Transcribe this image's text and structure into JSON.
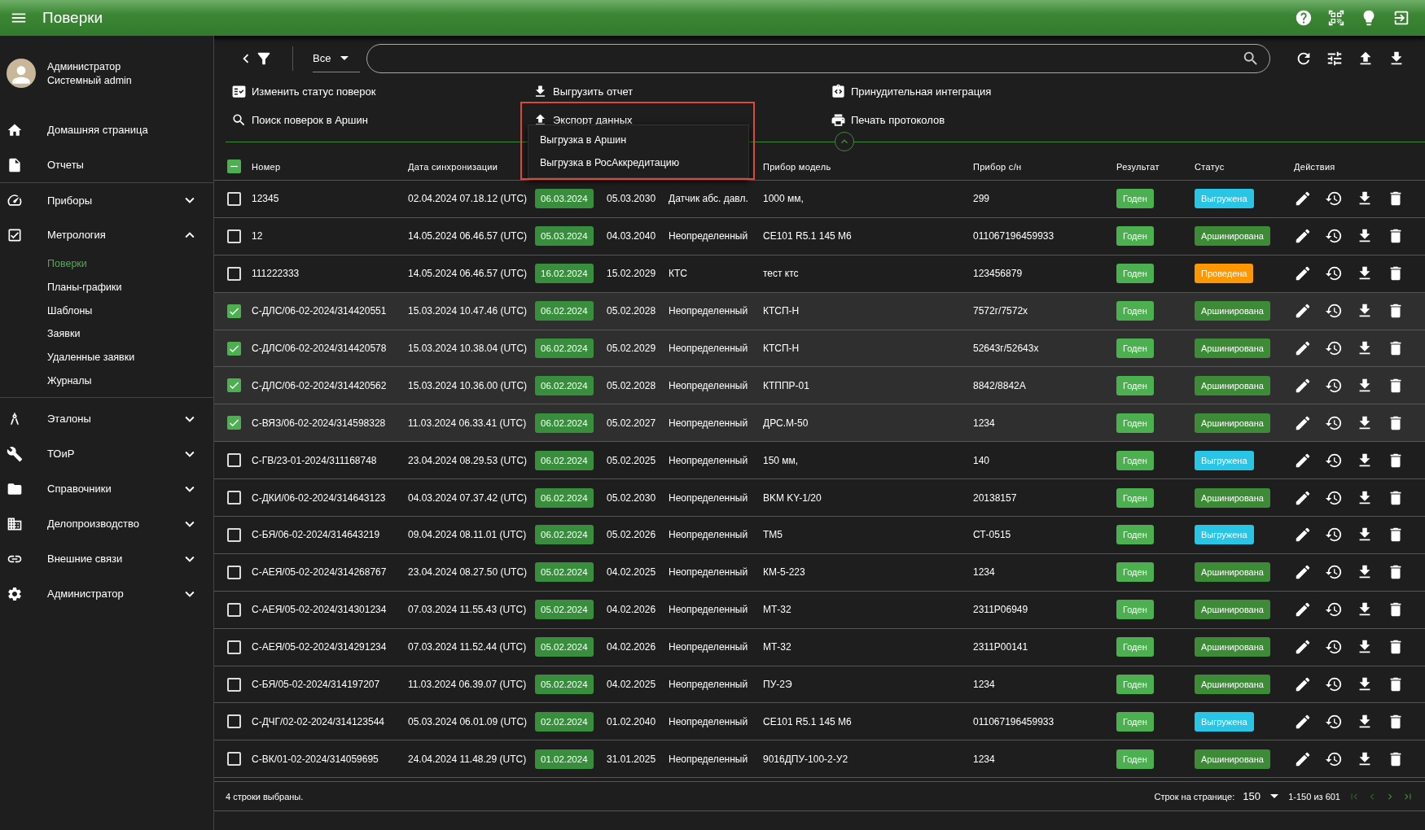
{
  "app_bar": {
    "title": "Поверки"
  },
  "user": {
    "role": "Администратор",
    "name": "Системный admin"
  },
  "sidebar": {
    "items": [
      {
        "label": "Домашняя страница",
        "kind": "link"
      },
      {
        "label": "Отчеты",
        "kind": "link"
      },
      {
        "label": "Приборы",
        "kind": "group",
        "expanded": false
      },
      {
        "label": "Метрология",
        "kind": "group",
        "expanded": true,
        "children": [
          {
            "label": "Поверки",
            "selected": true
          },
          {
            "label": "Планы-графики",
            "selected": false
          },
          {
            "label": "Шаблоны",
            "selected": false
          },
          {
            "label": "Заявки",
            "selected": false
          },
          {
            "label": "Удаленные заявки",
            "selected": false
          },
          {
            "label": "Журналы",
            "selected": false
          }
        ]
      },
      {
        "label": "Эталоны",
        "kind": "group",
        "expanded": false
      },
      {
        "label": "ТОиР",
        "kind": "group",
        "expanded": false
      },
      {
        "label": "Справочники",
        "kind": "group",
        "expanded": false
      },
      {
        "label": "Делопроизводство",
        "kind": "group",
        "expanded": false
      },
      {
        "label": "Внешние связи",
        "kind": "group",
        "expanded": false
      },
      {
        "label": "Администратор",
        "kind": "group",
        "expanded": false
      }
    ]
  },
  "filter": {
    "scope": "Все"
  },
  "actions": [
    {
      "label": "Изменить статус поверок"
    },
    {
      "label": "Выгрузить отчет"
    },
    {
      "label": "Принудительная интеграция"
    },
    {
      "label": "Поиск поверок в Аршин"
    },
    {
      "label": "Экспорт данных",
      "highlighted": true,
      "menu": [
        "Выгрузка в Аршин",
        "Выгрузка в РосАккредитацию"
      ]
    },
    {
      "label": "Печать протоколов"
    }
  ],
  "table": {
    "select_all_indeterminate": true,
    "columns": {
      "number": "Номер",
      "sync": "Дата синхронизации",
      "model": "Прибор модель",
      "serial": "Прибор с/н",
      "result": "Результат",
      "status": "Статус",
      "actions": "Действия"
    },
    "rows": [
      {
        "selected": false,
        "number": "12345",
        "sync": "02.04.2024 07.18.12 (UTC)",
        "date": "06.03.2024",
        "until": "05.03.2030",
        "type": "Датчик абс. давл.",
        "model": "1000 мм,",
        "serial": "299",
        "result": "Годен",
        "status": "Выгружена",
        "color": "#29c5e6"
      },
      {
        "selected": false,
        "number": "12",
        "sync": "14.05.2024 06.46.57 (UTC)",
        "date": "05.03.2024",
        "until": "04.03.2040",
        "type": "Неопределенный",
        "model": "CE101 R5.1 145 M6",
        "serial": "011067196459933",
        "result": "Годен",
        "status": "Аршинирована",
        "color": "#3d8b37"
      },
      {
        "selected": false,
        "number": "111222333",
        "sync": "14.05.2024 06.46.57 (UTC)",
        "date": "16.02.2024",
        "until": "15.02.2029",
        "type": "КТС",
        "model": "тест ктс",
        "serial": "123456879",
        "result": "Годен",
        "status": "Проведена",
        "color": "#ff9800"
      },
      {
        "selected": true,
        "number": "С-ДЛС/06-02-2024/314420551",
        "sync": "15.03.2024 10.47.46 (UTC)",
        "date": "06.02.2024",
        "until": "05.02.2028",
        "type": "Неопределенный",
        "model": "КТСП-Н",
        "serial": "7572г/7572х",
        "result": "Годен",
        "status": "Аршинирована",
        "color": "#3d8b37"
      },
      {
        "selected": true,
        "number": "С-ДЛС/06-02-2024/314420578",
        "sync": "15.03.2024 10.38.04 (UTC)",
        "date": "06.02.2024",
        "until": "05.02.2029",
        "type": "Неопределенный",
        "model": "КТСП-Н",
        "serial": "52643г/52643х",
        "result": "Годен",
        "status": "Аршинирована",
        "color": "#3d8b37"
      },
      {
        "selected": true,
        "number": "С-ДЛС/06-02-2024/314420562",
        "sync": "15.03.2024 10.36.00 (UTC)",
        "date": "06.02.2024",
        "until": "05.02.2028",
        "type": "Неопределенный",
        "model": "КТППР-01",
        "serial": "8842/8842А",
        "result": "Годен",
        "status": "Аршинирована",
        "color": "#3d8b37"
      },
      {
        "selected": true,
        "number": "С-ВЯЗ/06-02-2024/314598328",
        "sync": "11.03.2024 06.33.41 (UTC)",
        "date": "06.02.2024",
        "until": "05.02.2027",
        "type": "Неопределенный",
        "model": "ДРС.М-50",
        "serial": "1234",
        "result": "Годен",
        "status": "Аршинирована",
        "color": "#3d8b37"
      },
      {
        "selected": false,
        "number": "С-ГВ/23-01-2024/311168748",
        "sync": "23.04.2024 08.29.53 (UTC)",
        "date": "06.02.2024",
        "until": "05.02.2025",
        "type": "Неопределенный",
        "model": "150 мм,",
        "serial": "140",
        "result": "Годен",
        "status": "Выгружена",
        "color": "#29c5e6"
      },
      {
        "selected": false,
        "number": "С-ДКИ/06-02-2024/314643123",
        "sync": "04.03.2024 07.37.42 (UTC)",
        "date": "06.02.2024",
        "until": "05.02.2030",
        "type": "Неопределенный",
        "model": "BKM KY-1/20",
        "serial": "20138157",
        "result": "Годен",
        "status": "Аршинирована",
        "color": "#3d8b37"
      },
      {
        "selected": false,
        "number": "С-БЯ/06-02-2024/314643219",
        "sync": "09.04.2024 08.11.01 (UTC)",
        "date": "06.02.2024",
        "until": "05.02.2026",
        "type": "Неопределенный",
        "model": "ТМ5",
        "serial": "СТ-0515",
        "result": "Годен",
        "status": "Выгружена",
        "color": "#29c5e6"
      },
      {
        "selected": false,
        "number": "С-АЕЯ/05-02-2024/314268767",
        "sync": "23.04.2024 08.27.50 (UTC)",
        "date": "05.02.2024",
        "until": "04.02.2025",
        "type": "Неопределенный",
        "model": "КМ-5-223",
        "serial": "1234",
        "result": "Годен",
        "status": "Аршинирована",
        "color": "#3d8b37"
      },
      {
        "selected": false,
        "number": "С-АЕЯ/05-02-2024/314301234",
        "sync": "07.03.2024 11.55.43 (UTC)",
        "date": "05.02.2024",
        "until": "04.02.2026",
        "type": "Неопределенный",
        "model": "МТ-32",
        "serial": "2311P06949",
        "result": "Годен",
        "status": "Аршинирована",
        "color": "#3d8b37"
      },
      {
        "selected": false,
        "number": "С-АЕЯ/05-02-2024/314291234",
        "sync": "07.03.2024 11.52.44 (UTC)",
        "date": "05.02.2024",
        "until": "04.02.2026",
        "type": "Неопределенный",
        "model": "МТ-32",
        "serial": "2311P00141",
        "result": "Годен",
        "status": "Аршинирована",
        "color": "#3d8b37"
      },
      {
        "selected": false,
        "number": "С-БЯ/05-02-2024/314197207",
        "sync": "11.03.2024 06.39.07 (UTC)",
        "date": "05.02.2024",
        "until": "04.02.2025",
        "type": "Неопределенный",
        "model": "ПУ-2Э",
        "serial": "1234",
        "result": "Годен",
        "status": "Аршинирована",
        "color": "#3d8b37"
      },
      {
        "selected": false,
        "number": "С-ДЧГ/02-02-2024/314123544",
        "sync": "05.03.2024 06.01.09 (UTC)",
        "date": "02.02.2024",
        "until": "01.02.2040",
        "type": "Неопределенный",
        "model": "CE101 R5.1 145 M6",
        "serial": "011067196459933",
        "result": "Годен",
        "status": "Выгружена",
        "color": "#29c5e6"
      },
      {
        "selected": false,
        "number": "С-ВК/01-02-2024/314059695",
        "sync": "24.04.2024 11.48.29 (UTC)",
        "date": "01.02.2024",
        "until": "31.01.2025",
        "type": "Неопределенный",
        "model": "9016ДПУ-100-2-У2",
        "serial": "1234",
        "result": "Годен",
        "status": "Аршинирована",
        "color": "#3d8b37"
      }
    ]
  },
  "footer": {
    "selection": "4 строки выбраны.",
    "rows_per_page_label": "Строк на странице:",
    "rows_per_page": "150",
    "range": "1-150 из 601"
  }
}
